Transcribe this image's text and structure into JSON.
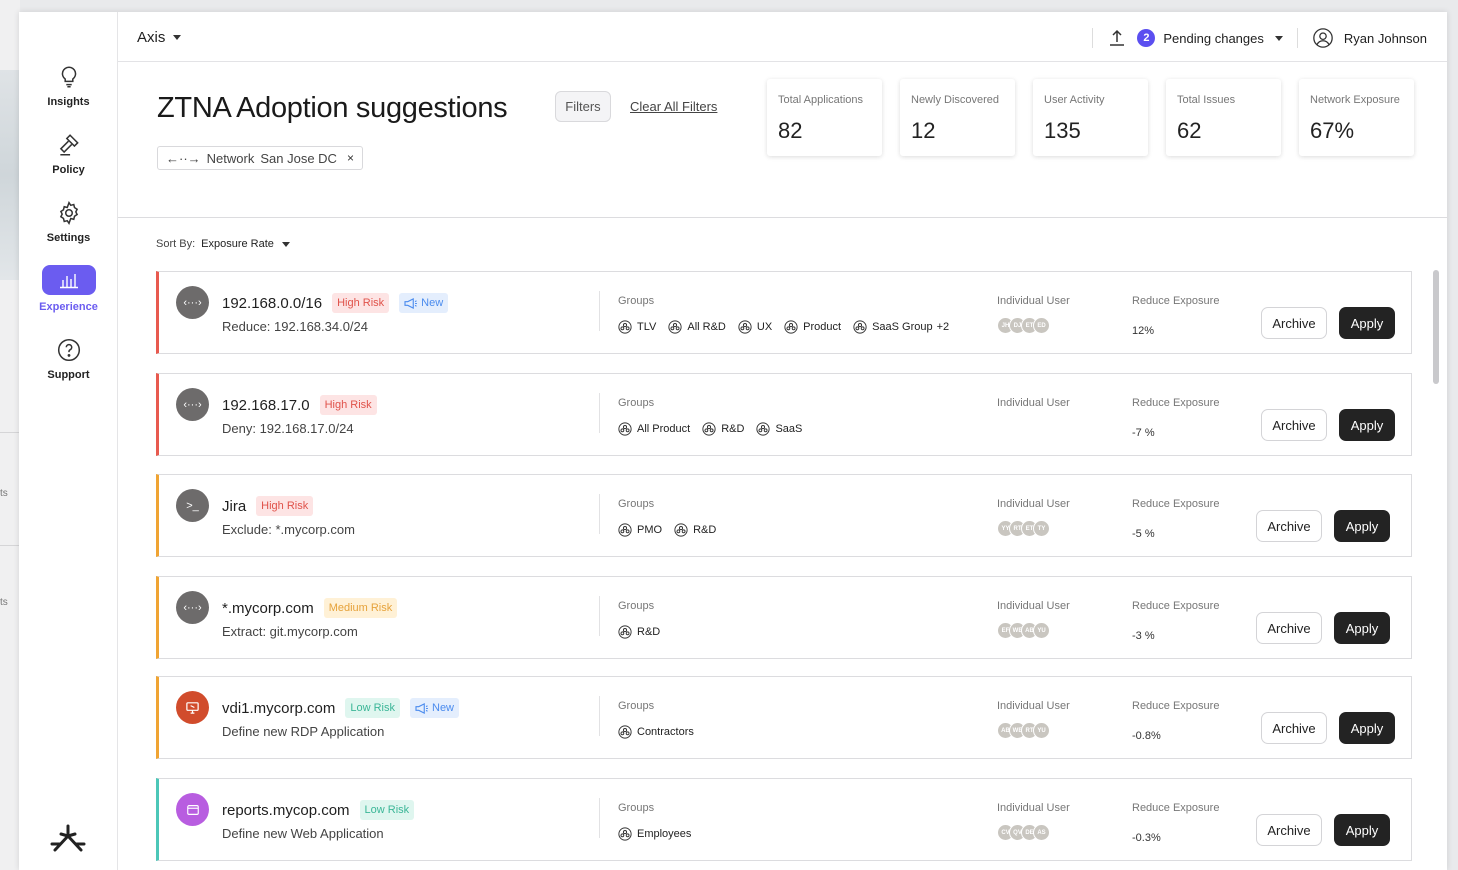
{
  "background": {
    "fragments": [
      "ts",
      "ts"
    ]
  },
  "sidebar": {
    "items": [
      {
        "label": "Insights",
        "icon": "lightbulb-icon"
      },
      {
        "label": "Policy",
        "icon": "gavel-icon"
      },
      {
        "label": "Settings",
        "icon": "gear-icon"
      },
      {
        "label": "Experience",
        "icon": "bar-chart-icon",
        "active": true
      },
      {
        "label": "Support",
        "icon": "question-icon"
      }
    ]
  },
  "topbar": {
    "workspace": "Axis",
    "pending_count": "2",
    "pending_label": "Pending changes",
    "user_name": "Ryan Johnson"
  },
  "header": {
    "title": "ZTNA Adoption suggestions",
    "filters_label": "Filters",
    "clear_filters_label": "Clear All Filters",
    "chip_label": "Network",
    "chip_value": "San Jose DC",
    "chip_remove": "×"
  },
  "stats": [
    {
      "label": "Total Applications",
      "value": "82"
    },
    {
      "label": "Newly Discovered",
      "value": "12"
    },
    {
      "label": "User Activity",
      "value": "135"
    },
    {
      "label": "Total Issues",
      "value": "62"
    },
    {
      "label": "Network Exposure",
      "value": "67%"
    }
  ],
  "sort": {
    "label": "Sort By:",
    "value": "Exposure Rate"
  },
  "labels": {
    "groups": "Groups",
    "individual_user": "Individual User",
    "reduce_exposure": "Reduce Exposure",
    "archive": "Archive",
    "apply": "Apply",
    "new": "New"
  },
  "rows": [
    {
      "title": "192.168.0.0/16",
      "risk": "High Risk",
      "is_new": true,
      "sub": "Reduce: 192.168.34.0/24",
      "groups": [
        "TLV",
        "All R&D",
        "UX",
        "Product",
        "SaaS Group"
      ],
      "groups_more": "+2",
      "users": [
        "JH",
        "DJ",
        "ET",
        "ED"
      ],
      "exposure": "12%"
    },
    {
      "title": "192.168.17.0",
      "risk": "High Risk",
      "is_new": false,
      "sub": "Deny: 192.168.17.0/24",
      "groups": [
        "All Product",
        "R&D",
        "SaaS"
      ],
      "groups_more": "",
      "users": [],
      "exposure": "-7 %"
    },
    {
      "title": "Jira",
      "risk": "High Risk",
      "is_new": false,
      "sub": "Exclude: *.mycorp.com",
      "groups": [
        "PMO",
        "R&D"
      ],
      "groups_more": "",
      "users": [
        "YY",
        "RT",
        "ET",
        "TY"
      ],
      "exposure": "-5 %"
    },
    {
      "title": "*.mycorp.com",
      "risk": "Medium Risk",
      "is_new": false,
      "sub": "Extract: git.mycorp.com",
      "groups": [
        "R&D"
      ],
      "groups_more": "",
      "users": [
        "EF",
        "WE",
        "AB",
        "YU"
      ],
      "exposure": "-3 %"
    },
    {
      "title": "vdi1.mycorp.com",
      "risk": "Low Risk",
      "is_new": true,
      "sub": "Define new RDP Application",
      "groups": [
        "Contractors"
      ],
      "groups_more": "",
      "users": [
        "AB",
        "WE",
        "RT",
        "YU"
      ],
      "exposure": "-0.8%"
    },
    {
      "title": "reports.mycop.com",
      "risk": "Low Risk",
      "is_new": false,
      "sub": "Define new Web Application",
      "groups": [
        "Employees"
      ],
      "groups_more": "",
      "users": [
        "CV",
        "QV",
        "DE",
        "AS"
      ],
      "exposure": "-0.3%"
    }
  ]
}
